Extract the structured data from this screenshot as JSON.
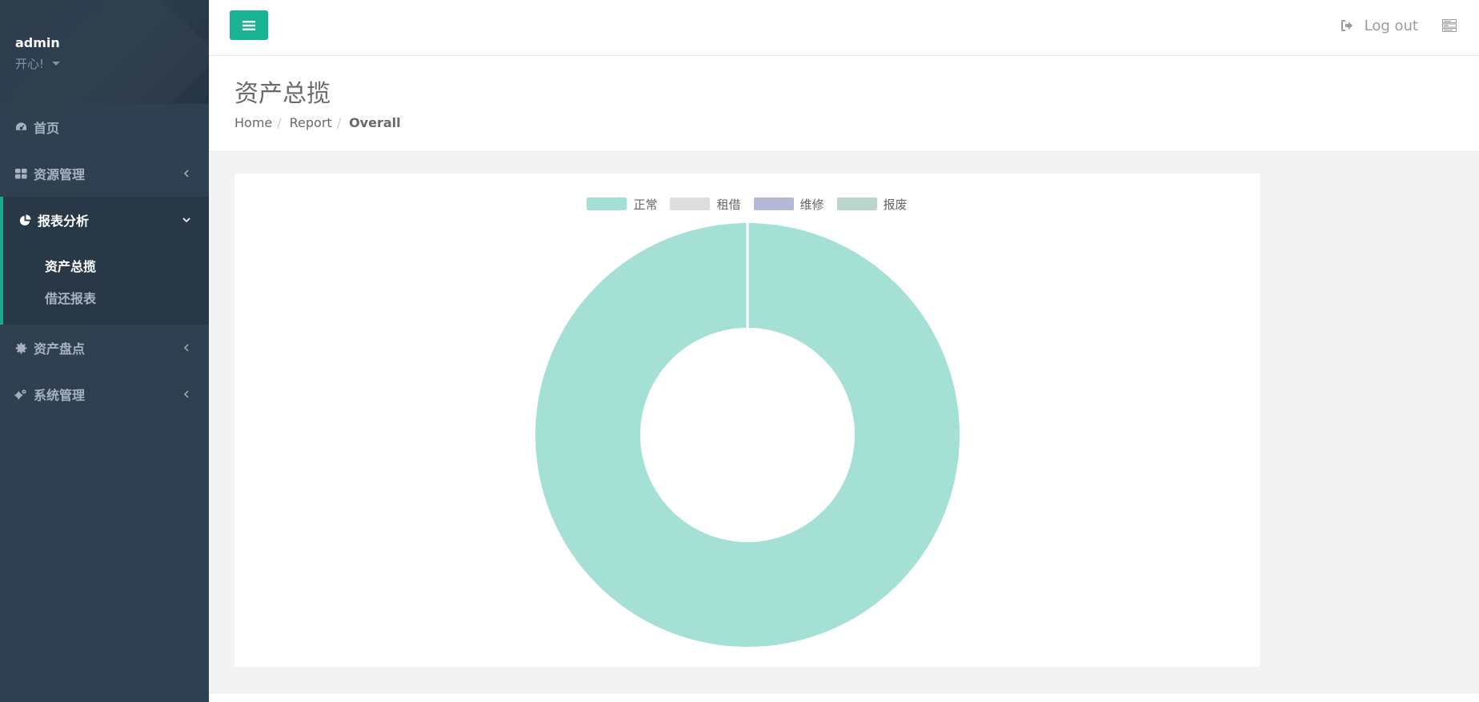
{
  "sidebar": {
    "profile": {
      "name": "admin",
      "status": "开心!"
    },
    "items": [
      {
        "label": "首页",
        "icon": "dashboard-icon"
      },
      {
        "label": "资源管理",
        "icon": "grid-icon",
        "arrow": "chevron-left-icon"
      },
      {
        "label": "报表分析",
        "icon": "pie-chart-icon",
        "arrow": "chevron-down-icon"
      },
      {
        "label": "资产盘点",
        "icon": "gear-icon",
        "arrow": "chevron-left-icon"
      },
      {
        "label": "系统管理",
        "icon": "cogs-icon",
        "arrow": "chevron-left-icon"
      }
    ],
    "subitems": [
      {
        "label": "资产总揽",
        "active": true
      },
      {
        "label": "借还报表",
        "active": false
      }
    ]
  },
  "topbar": {
    "menu_icon": "hamburger-icon",
    "logout_label": "Log out",
    "logout_icon": "sign-out-icon",
    "tasks_icon": "tasks-icon"
  },
  "heading": {
    "title": "资产总揽",
    "breadcrumb": [
      "Home",
      "Report",
      "Overall"
    ]
  },
  "colors": {
    "sidebar_bg": "#2f4050",
    "accent": "#1ab394"
  },
  "chart_data": {
    "type": "pie",
    "variant": "doughnut",
    "legend_position": "top",
    "categories": [
      "正常",
      "租借",
      "维修",
      "报废"
    ],
    "values": [
      1,
      0,
      0,
      0
    ],
    "colors": [
      "#a4e1d4",
      "#dedede",
      "#b5b8d6",
      "#bad5cd"
    ]
  }
}
